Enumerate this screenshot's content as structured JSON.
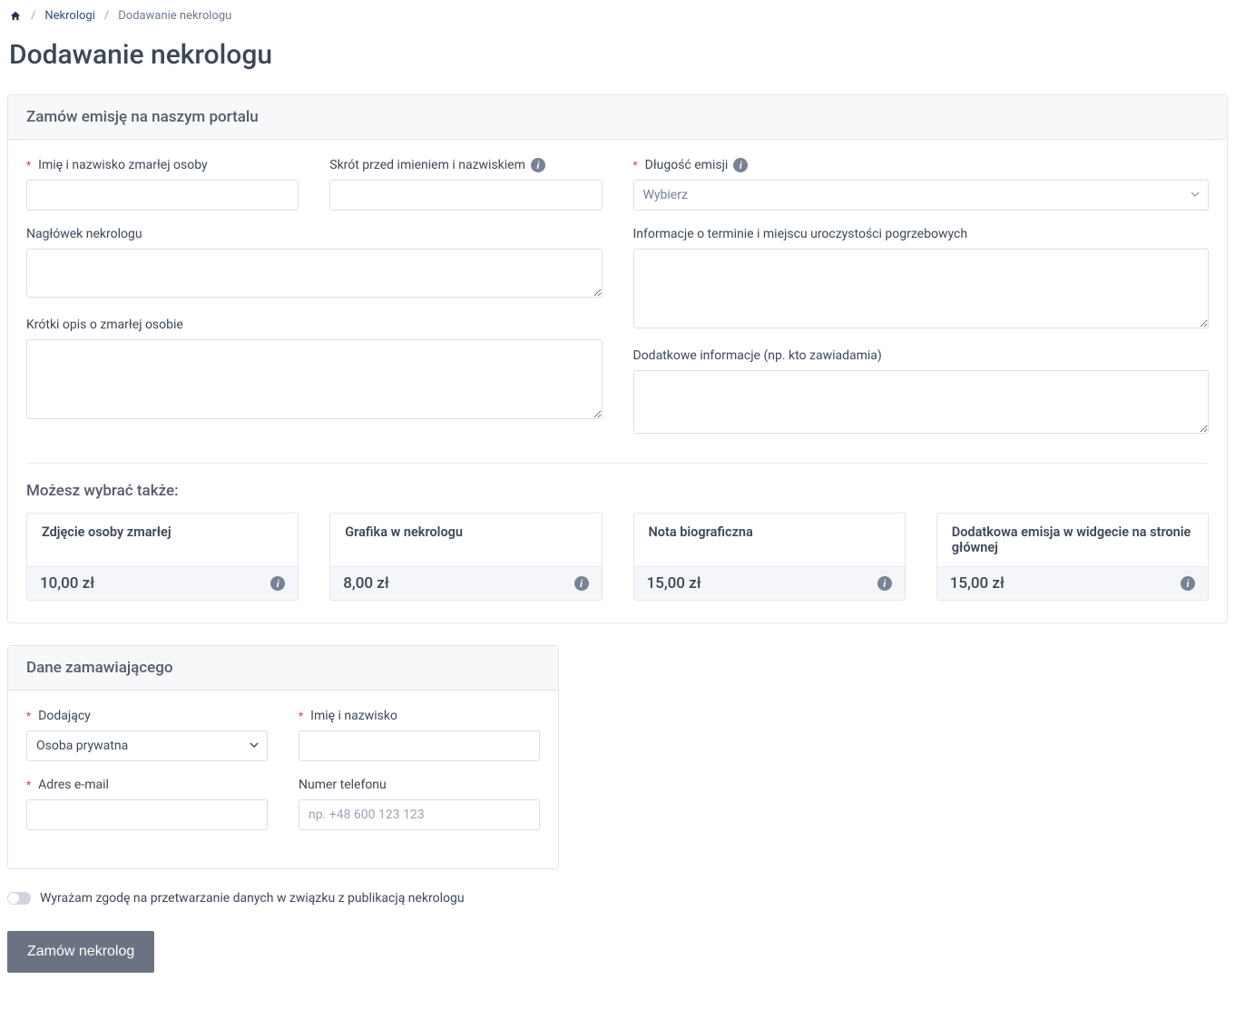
{
  "breadcrumb": {
    "link1": "Nekrologi",
    "current": "Dodawanie nekrologu"
  },
  "page_title": "Dodawanie nekrologu",
  "card1": {
    "title": "Zamów emisję na naszym portalu",
    "labels": {
      "name": "Imię i nazwisko zmarłej osoby",
      "prefix": "Skrót przed imieniem i nazwiskiem",
      "duration": "Długość emisji",
      "duration_placeholder": "Wybierz",
      "header": "Nagłówek nekrologu",
      "ceremony_info": "Informacje o terminie i miejscu uroczystości pogrzebowych",
      "short_desc": "Krótki opis o zmarłej osobie",
      "extra": "Dodatkowe informacje (np. kto zawiadamia)"
    },
    "subtitle": "Możesz wybrać także:",
    "options": [
      {
        "title": "Zdjęcie osoby zmarłej",
        "price": "10,00 zł"
      },
      {
        "title": "Grafika w nekrologu",
        "price": "8,00 zł"
      },
      {
        "title": "Nota biograficzna",
        "price": "15,00 zł"
      },
      {
        "title": "Dodatkowa emisja w widgecie na stronie głównej",
        "price": "15,00 zł"
      }
    ]
  },
  "card2": {
    "title": "Dane zamawiającego",
    "labels": {
      "adder": "Dodający",
      "adder_value": "Osoba prywatna",
      "fullname": "Imię i nazwisko",
      "email": "Adres e-mail",
      "phone": "Numer telefonu",
      "phone_placeholder": "np. +48 600 123 123"
    }
  },
  "consent_text": "Wyrażam zgodę na przetwarzanie danych w związku z publikacją nekrologu",
  "submit_label": "Zamów nekrolog"
}
